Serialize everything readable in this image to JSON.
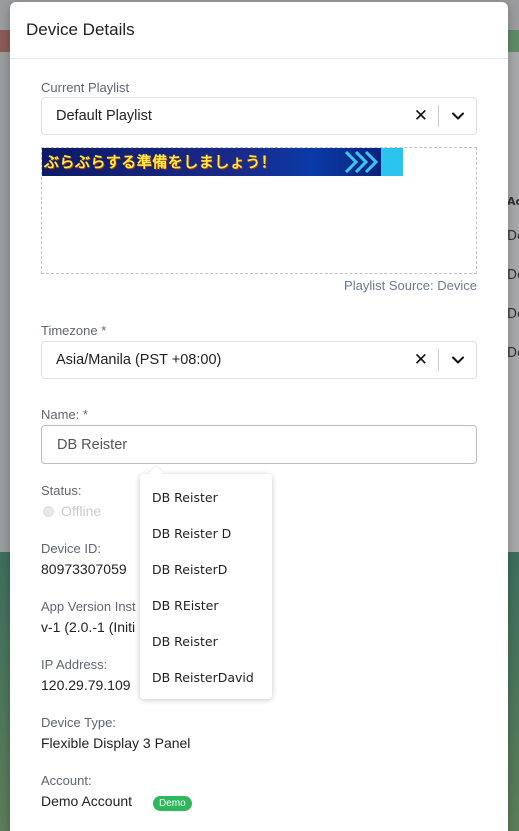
{
  "modal": {
    "title": "Device Details"
  },
  "current_playlist": {
    "label": "Current Playlist",
    "value": "Default Playlist",
    "banner_text": "ぶらぶらする準備をしましょう！",
    "source": "Playlist Source: Device"
  },
  "timezone": {
    "label": "Timezone *",
    "value": "Asia/Manila (PST +08:00)"
  },
  "name_field": {
    "label": "Name: *",
    "value": "DB Reister"
  },
  "autocomplete": {
    "items": [
      "DB Reister",
      "DB Reister D",
      "DB ReisterD",
      "DB REister",
      "DB Reister",
      "DB ReisterDavid"
    ]
  },
  "status": {
    "label": "Status:",
    "value": "Offline"
  },
  "device_id": {
    "label": "Device ID:",
    "value": "80973307059"
  },
  "app_version": {
    "label": "App Version Inst",
    "value": "v-1 (2.0.-1 (Initi"
  },
  "ip_address": {
    "label": "IP Address:",
    "value": "120.29.79.109"
  },
  "device_type": {
    "label": "Device Type:",
    "value": "Flexible Display 3 Panel"
  },
  "account": {
    "label": "Account:",
    "value": "Demo Account",
    "badge": "Demo"
  },
  "background": {
    "right_column_header": "Acc",
    "right_column_rows": [
      "Dem",
      "Dem",
      "Dem",
      "Dem"
    ]
  },
  "icons": {
    "clear": "close-icon",
    "dropdown": "chevron-down-icon"
  },
  "colors": {
    "badge_green": "#2eb85c",
    "banner_yellow": "#ffe94a",
    "banner_blue": "#0d1a66"
  }
}
